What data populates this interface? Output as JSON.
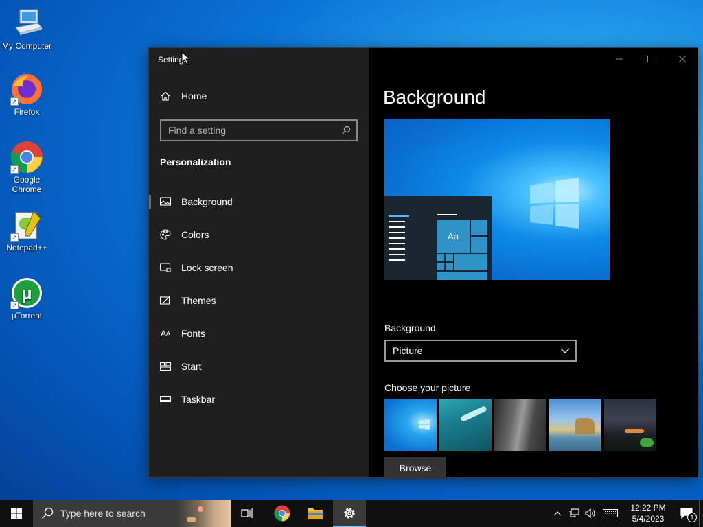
{
  "desktop": {
    "icons": [
      {
        "label": "My Computer",
        "icon": "computer-icon"
      },
      {
        "label": "Firefox",
        "icon": "firefox-icon"
      },
      {
        "label": "Google Chrome",
        "icon": "chrome-icon"
      },
      {
        "label": "Notepad++",
        "icon": "notepadpp-icon"
      },
      {
        "label": "µTorrent",
        "icon": "utorrent-icon"
      }
    ]
  },
  "window": {
    "title": "Settings",
    "home_label": "Home",
    "search_placeholder": "Find a setting",
    "section_title": "Personalization",
    "nav": [
      {
        "label": "Background",
        "icon": "picture-icon",
        "active": true
      },
      {
        "label": "Colors",
        "icon": "palette-icon",
        "active": false
      },
      {
        "label": "Lock screen",
        "icon": "lock-screen-icon",
        "active": false
      },
      {
        "label": "Themes",
        "icon": "themes-icon",
        "active": false
      },
      {
        "label": "Fonts",
        "icon": "fonts-icon",
        "active": false
      },
      {
        "label": "Start",
        "icon": "start-icon",
        "active": false
      },
      {
        "label": "Taskbar",
        "icon": "taskbar-icon",
        "active": false
      }
    ],
    "content": {
      "page_title": "Background",
      "preview_sample_text": "Aa",
      "background_label": "Background",
      "background_value": "Picture",
      "choose_picture_label": "Choose your picture",
      "browse_label": "Browse"
    }
  },
  "taskbar": {
    "search_placeholder": "Type here to search",
    "clock_time": "12:22 PM",
    "clock_date": "5/4/2023",
    "notification_count": "1"
  },
  "colors": {
    "window_left_bg": "#1f1f1f",
    "window_right_bg": "#000000",
    "taskbar_bg": "#101010",
    "accent": "#76b9ed"
  }
}
